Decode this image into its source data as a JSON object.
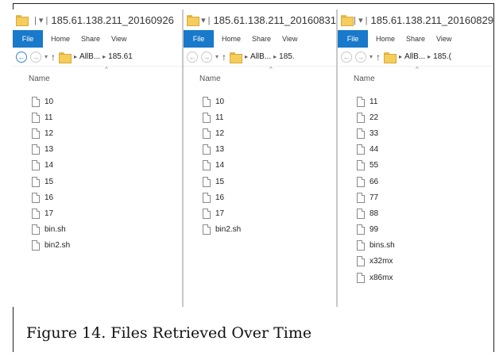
{
  "windows": [
    {
      "title": "185.61.138.211_20160926",
      "ribbon_tabs": [
        "File",
        "Home",
        "Share",
        "View"
      ],
      "breadcrumbs": [
        "AllB...",
        "185.61"
      ],
      "column_header": "Name",
      "files": [
        "10",
        "11",
        "12",
        "13",
        "14",
        "15",
        "16",
        "17",
        "bin.sh",
        "bin2.sh"
      ]
    },
    {
      "title": "185.61.138.211_20160831",
      "ribbon_tabs": [
        "File",
        "Home",
        "Share",
        "View"
      ],
      "breadcrumbs": [
        "AllB...",
        "185."
      ],
      "column_header": "Name",
      "files": [
        "10",
        "11",
        "12",
        "13",
        "14",
        "15",
        "16",
        "17",
        "bin2.sh"
      ]
    },
    {
      "title": "185.61.138.211_20160829",
      "ribbon_tabs": [
        "File",
        "Home",
        "Share",
        "View"
      ],
      "breadcrumbs": [
        "AllB...",
        "185.("
      ],
      "column_header": "Name",
      "files": [
        "11",
        "22",
        "33",
        "44",
        "55",
        "66",
        "77",
        "88",
        "99",
        "bins.sh",
        "x32mx",
        "x86mx"
      ]
    }
  ],
  "caption": "Figure 14. Files Retrieved Over Time",
  "colors": {
    "file_tab": "#1979ca",
    "folder": "#f5cd5a",
    "nav_active": "#3a83c8"
  },
  "icons": {
    "folder": "folder-icon",
    "document": "document-icon",
    "back": "back-arrow-icon",
    "forward": "forward-arrow-icon",
    "up": "up-arrow-icon"
  }
}
